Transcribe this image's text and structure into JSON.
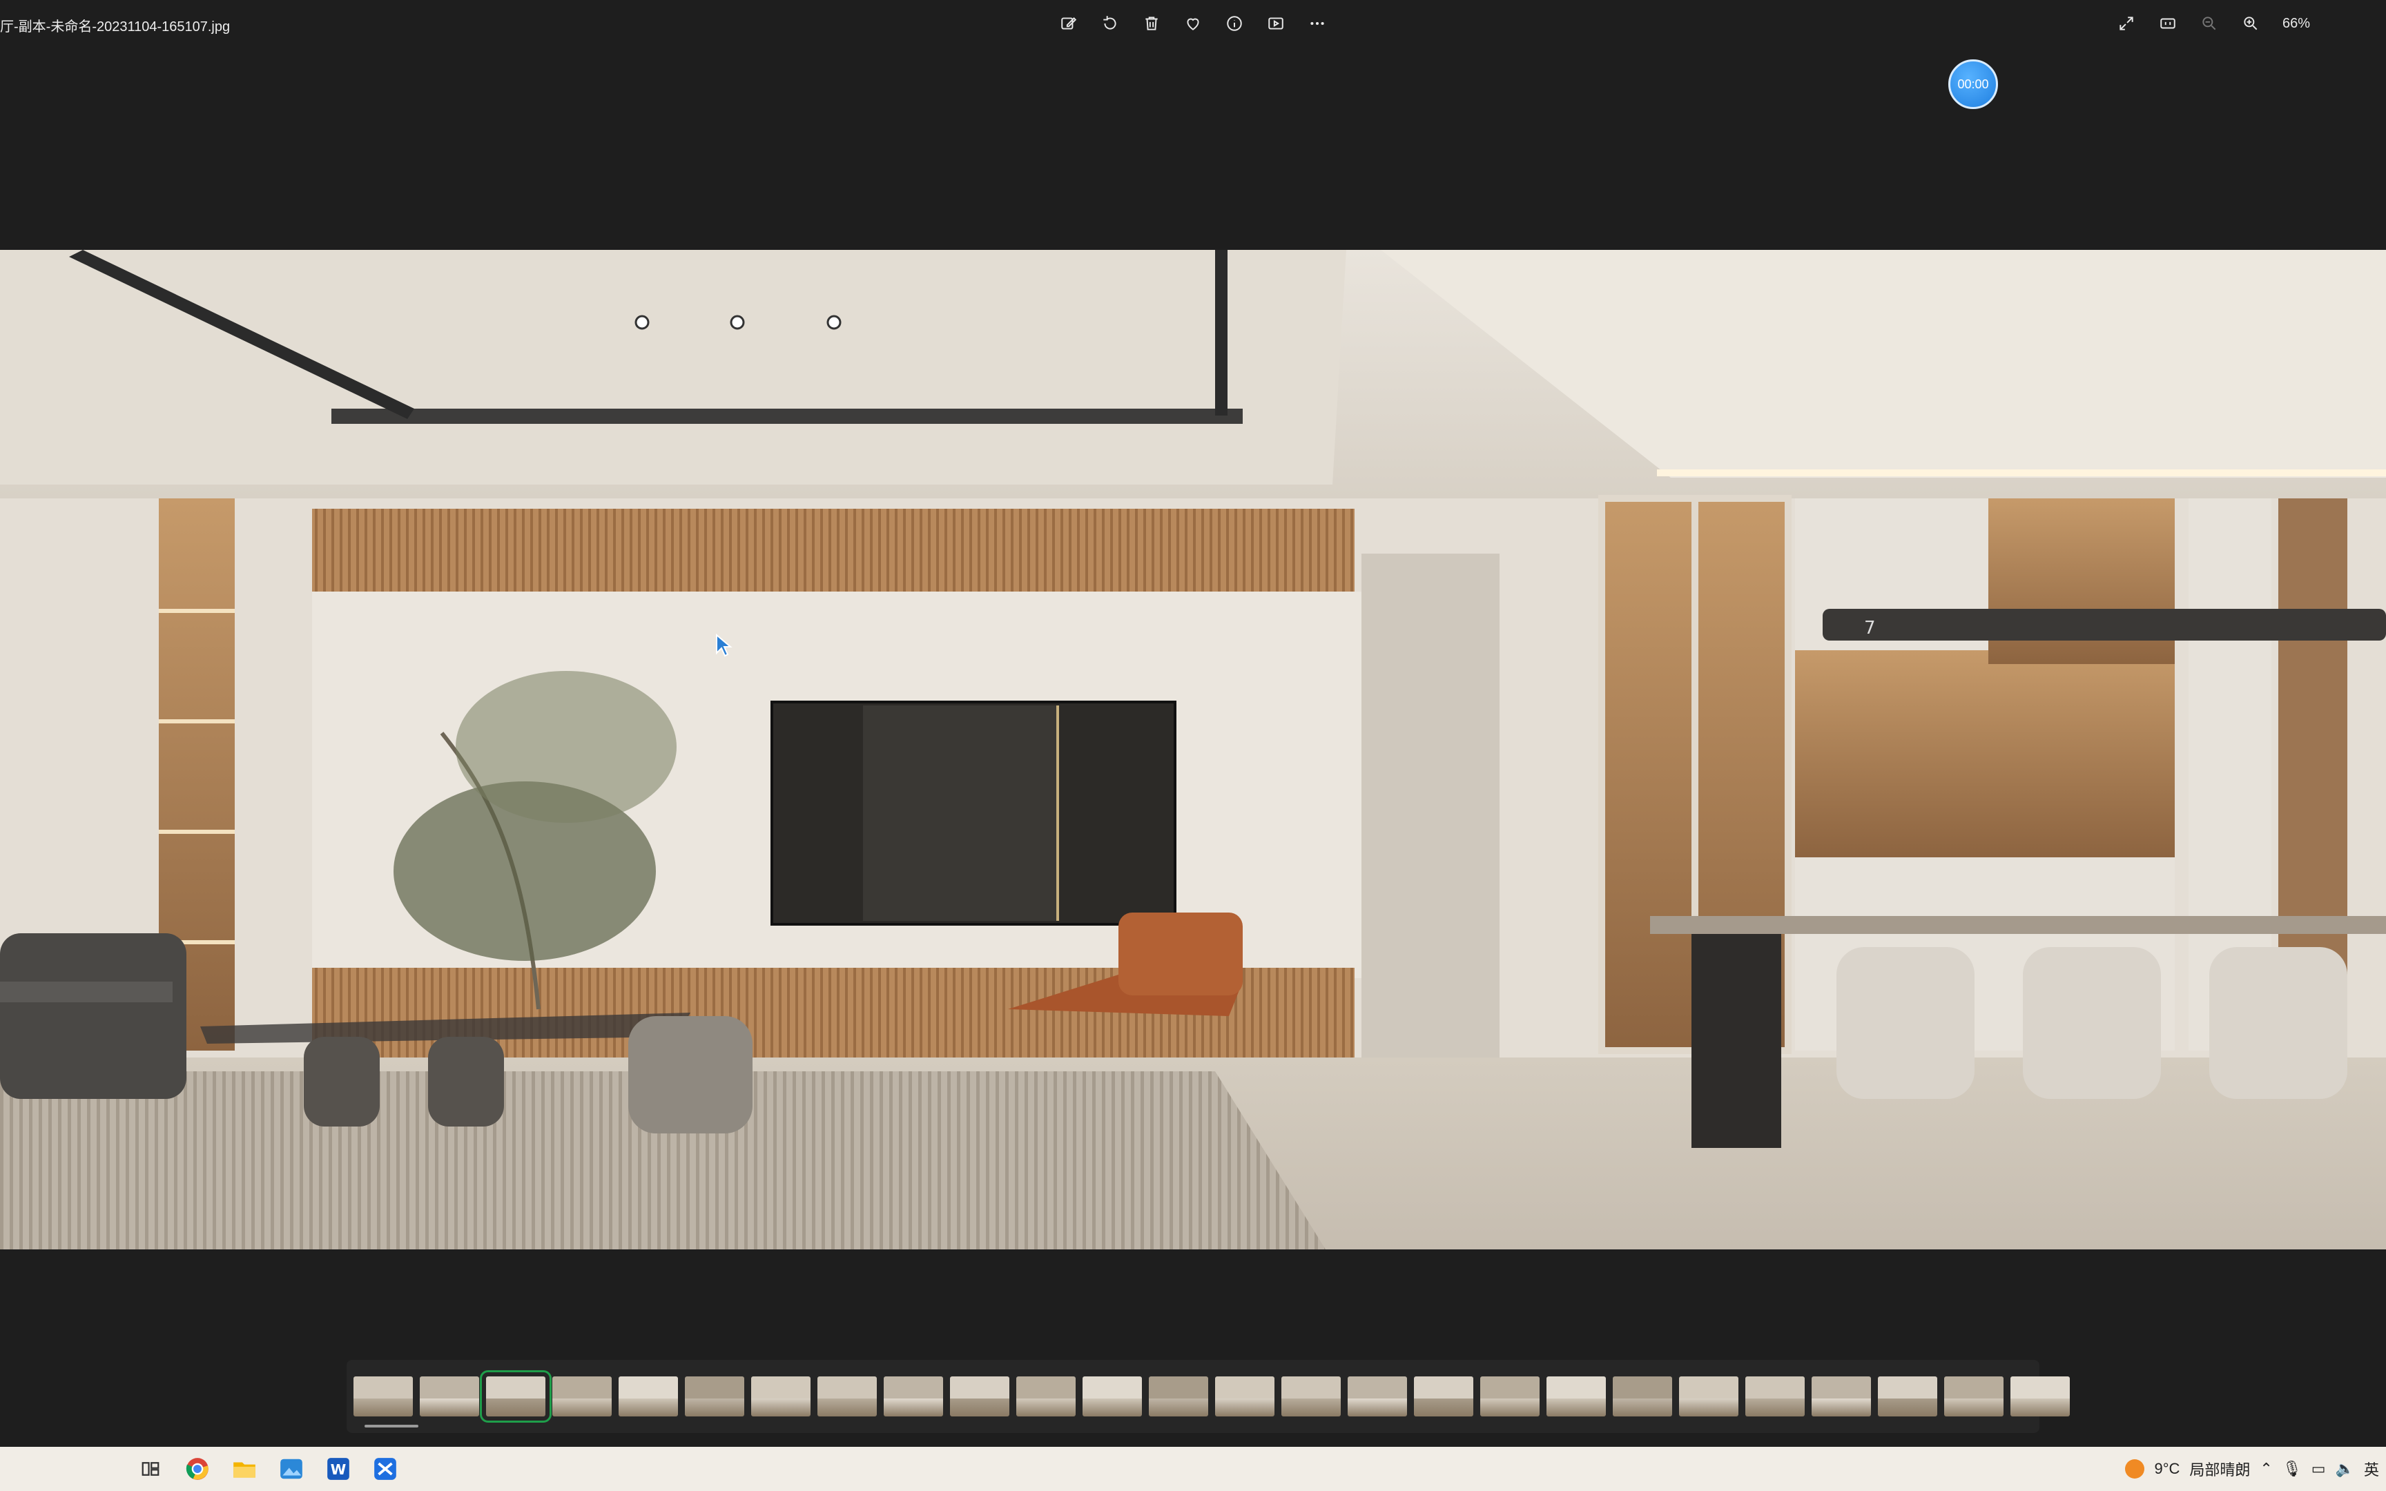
{
  "window": {
    "title": "厅-副本-未命名-20231104-165107.jpg",
    "zoom": "66%"
  },
  "toolbar": {
    "icons": [
      "edit-icon",
      "rotate-icon",
      "delete-icon",
      "heart-icon",
      "info-icon",
      "slideshow-icon",
      "more-icon"
    ]
  },
  "right_toolbar": {
    "icons": [
      "fullscreen-icon",
      "actual-size-icon",
      "zoom-out-icon",
      "zoom-in-icon"
    ]
  },
  "timer": {
    "label": "00:00"
  },
  "photo": {
    "overlay_number": "7"
  },
  "filmstrip": {
    "count": 26,
    "selected_index": 2,
    "active_index": 0
  },
  "taskbar": {
    "apps": [
      "task-view-icon",
      "chrome-icon",
      "file-explorer-icon",
      "photos-icon",
      "word-icon",
      "app-icon"
    ],
    "weather_temp": "9°C",
    "weather_desc": "局部晴朗",
    "lang": "英"
  }
}
